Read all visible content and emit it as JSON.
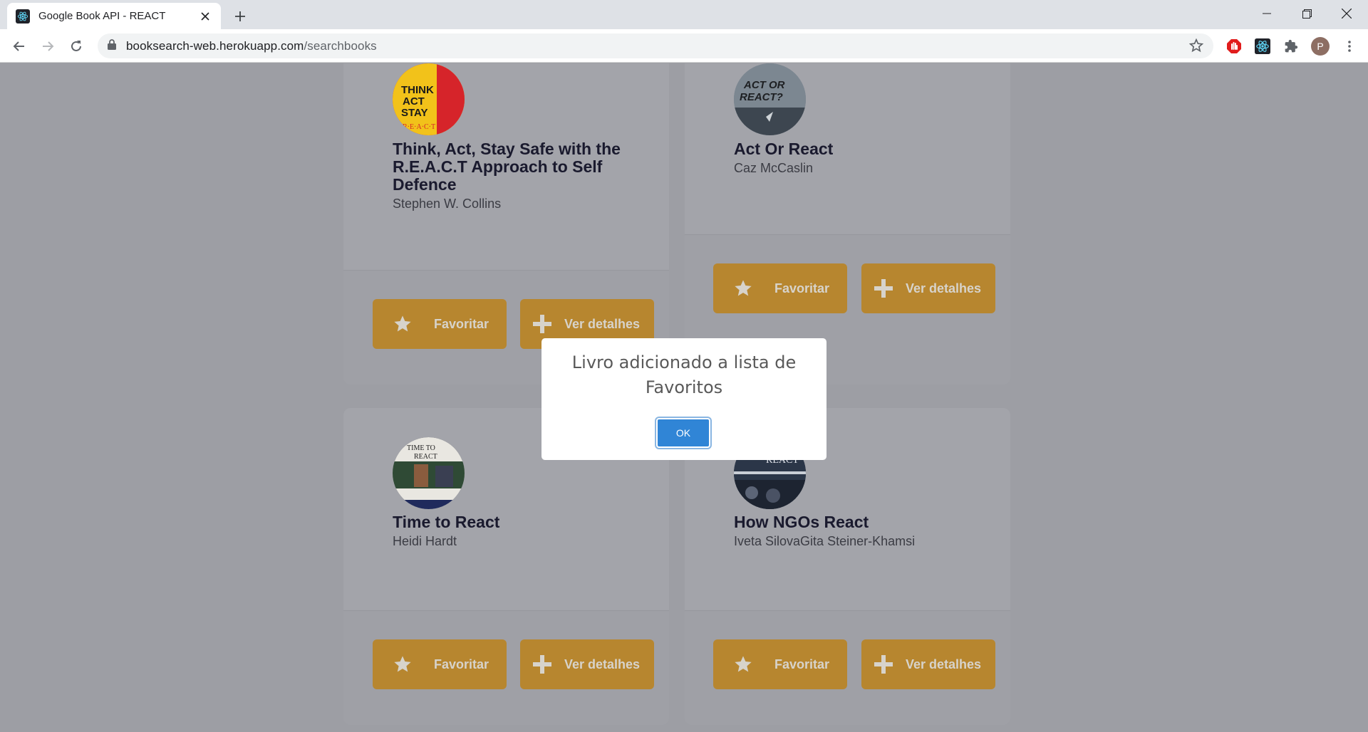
{
  "browser": {
    "tab_title": "Google Book API - REACT",
    "url_domain": "booksearch-web.herokuapp.com",
    "url_path": "/searchbooks",
    "profile_initial": "P"
  },
  "books": [
    {
      "title": "Think, Act, Stay Safe with the R.E.A.C.T Approach to Self Defence",
      "author": "Stephen W. Collins",
      "cover_text": "THINK ACT STAY SAFE"
    },
    {
      "title": "Act Or React",
      "author": "Caz McCaslin",
      "cover_text": "ACT OR REACT?"
    },
    {
      "title": "Time to React",
      "author": "Heidi Hardt",
      "cover_text": "TIME TO REACT"
    },
    {
      "title": "How NGOs React",
      "author": "Iveta SilovaGita Steiner-Khamsi",
      "cover_text": "REACT"
    }
  ],
  "buttons": {
    "favorite_label": "Favoritar",
    "details_label": "Ver detalhes"
  },
  "modal": {
    "message": "Livro adicionado a lista de Favoritos",
    "ok_label": "OK"
  }
}
